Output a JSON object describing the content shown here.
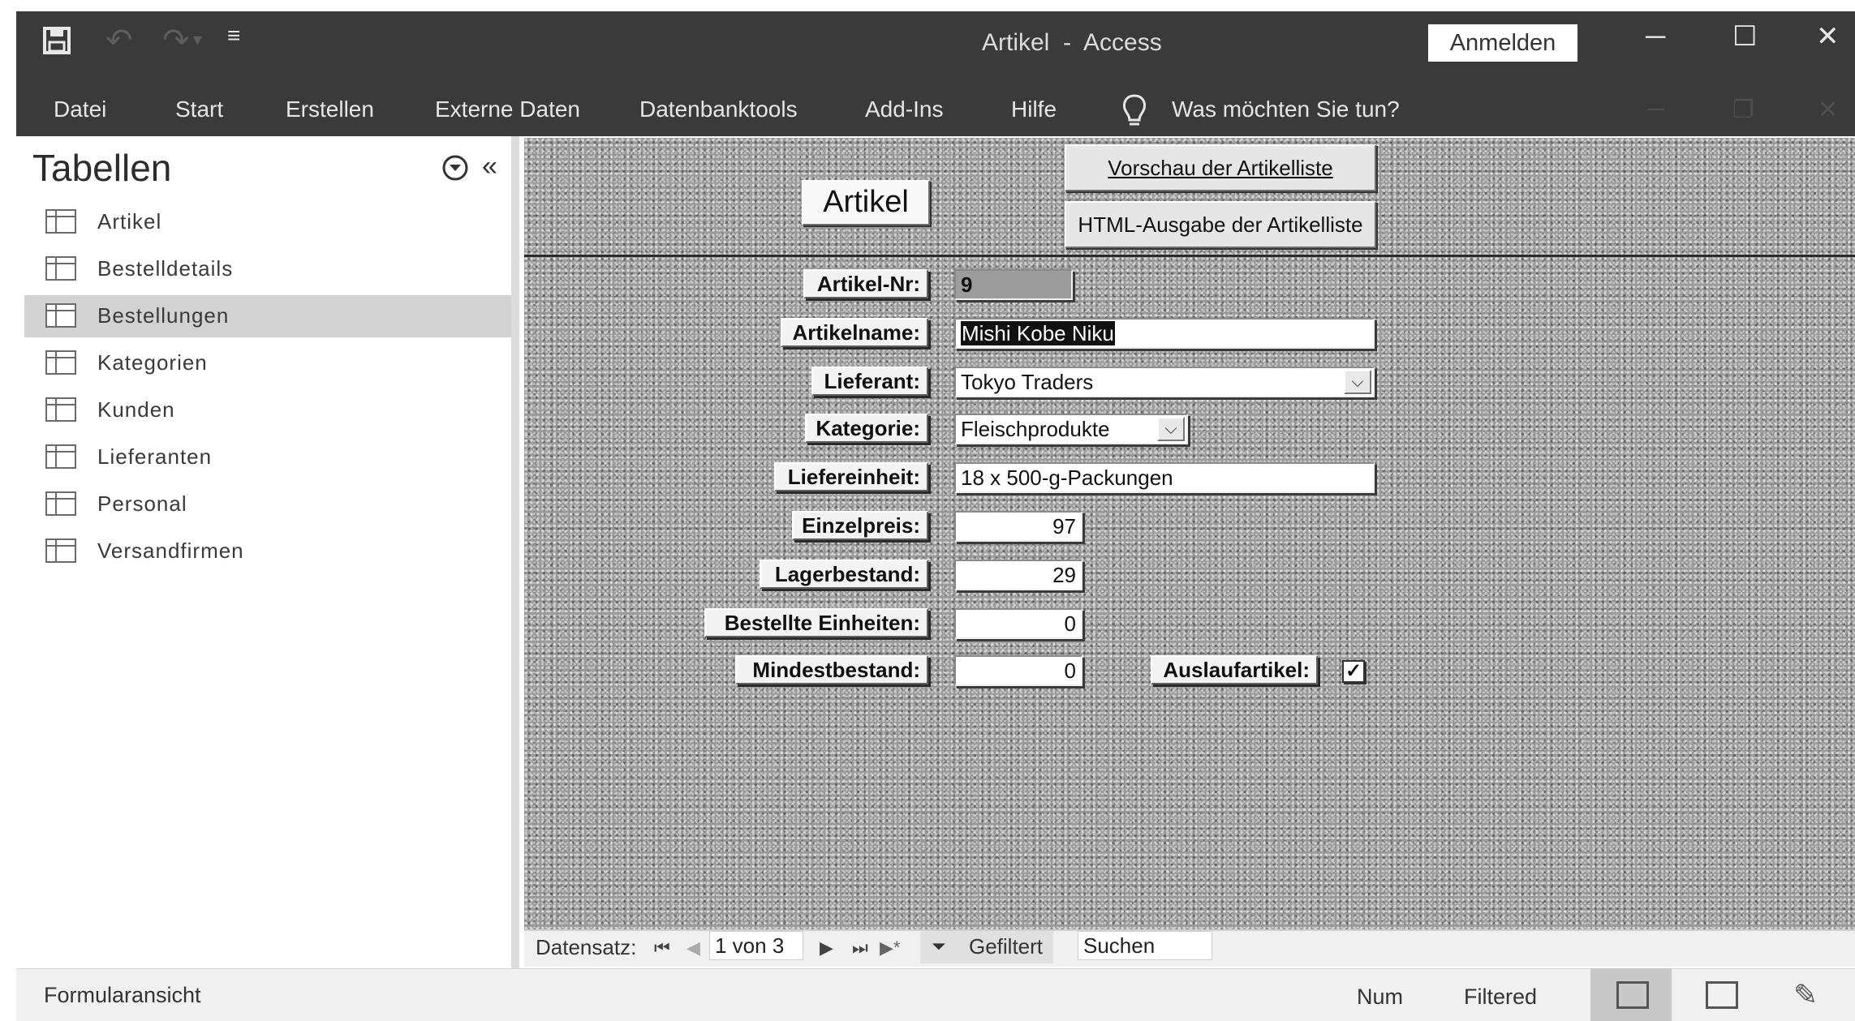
{
  "window": {
    "title": "Artikel  -  Access",
    "login_button": "Anmelden",
    "controls": {
      "minimize": "─",
      "maximize": "☐",
      "close": "✕"
    }
  },
  "quick_access": {
    "save": "save-icon",
    "undo": "undo-icon",
    "redo": "redo-icon",
    "customize": "customize-icon"
  },
  "menu": {
    "items": [
      "Datei",
      "Start",
      "Erstellen",
      "Externe Daten",
      "Datenbanktools",
      "Add-Ins",
      "Hilfe"
    ],
    "tell_me": "Was möchten Sie tun?"
  },
  "nav_pane": {
    "title": "Tabellen",
    "items": [
      {
        "label": "Artikel",
        "selected": false
      },
      {
        "label": "Bestelldetails",
        "selected": false
      },
      {
        "label": "Bestellungen",
        "selected": true
      },
      {
        "label": "Kategorien",
        "selected": false
      },
      {
        "label": "Kunden",
        "selected": false
      },
      {
        "label": "Lieferanten",
        "selected": false
      },
      {
        "label": "Personal",
        "selected": false
      },
      {
        "label": "Versandfirmen",
        "selected": false
      }
    ]
  },
  "form": {
    "title": "Artikel",
    "buttons": {
      "preview": "Vorschau der Artikelliste",
      "html_export": "HTML-Ausgabe der Artikelliste"
    },
    "fields": {
      "artikel_nr": {
        "label": "Artikel-Nr:",
        "value": "9"
      },
      "artikelname": {
        "label": "Artikelname:",
        "value": "Mishi Kobe Niku"
      },
      "lieferant": {
        "label": "Lieferant:",
        "value": "Tokyo Traders"
      },
      "kategorie": {
        "label": "Kategorie:",
        "value": "Fleischprodukte"
      },
      "liefereinheit": {
        "label": "Liefereinheit:",
        "value": "18 x 500-g-Packungen"
      },
      "einzelpreis": {
        "label": "Einzelpreis:",
        "value": "97"
      },
      "lagerbestand": {
        "label": "Lagerbestand:",
        "value": "29"
      },
      "bestellte_einheiten": {
        "label": "Bestellte Einheiten:",
        "value": "0"
      },
      "mindestbestand": {
        "label": "Mindestbestand:",
        "value": "0"
      },
      "auslaufartikel": {
        "label": "Auslaufartikel:",
        "checked": true,
        "check_glyph": "✓"
      }
    }
  },
  "record_nav": {
    "label": "Datensatz:",
    "position": "1 von 3",
    "filter_label": "Gefiltert",
    "search_placeholder": "Suchen",
    "first": "⏮",
    "prev": "◀",
    "next": "▶",
    "last": "⏭",
    "new": "▶*"
  },
  "status_bar": {
    "view_name": "Formularansicht",
    "num": "Num",
    "filtered": "Filtered"
  }
}
